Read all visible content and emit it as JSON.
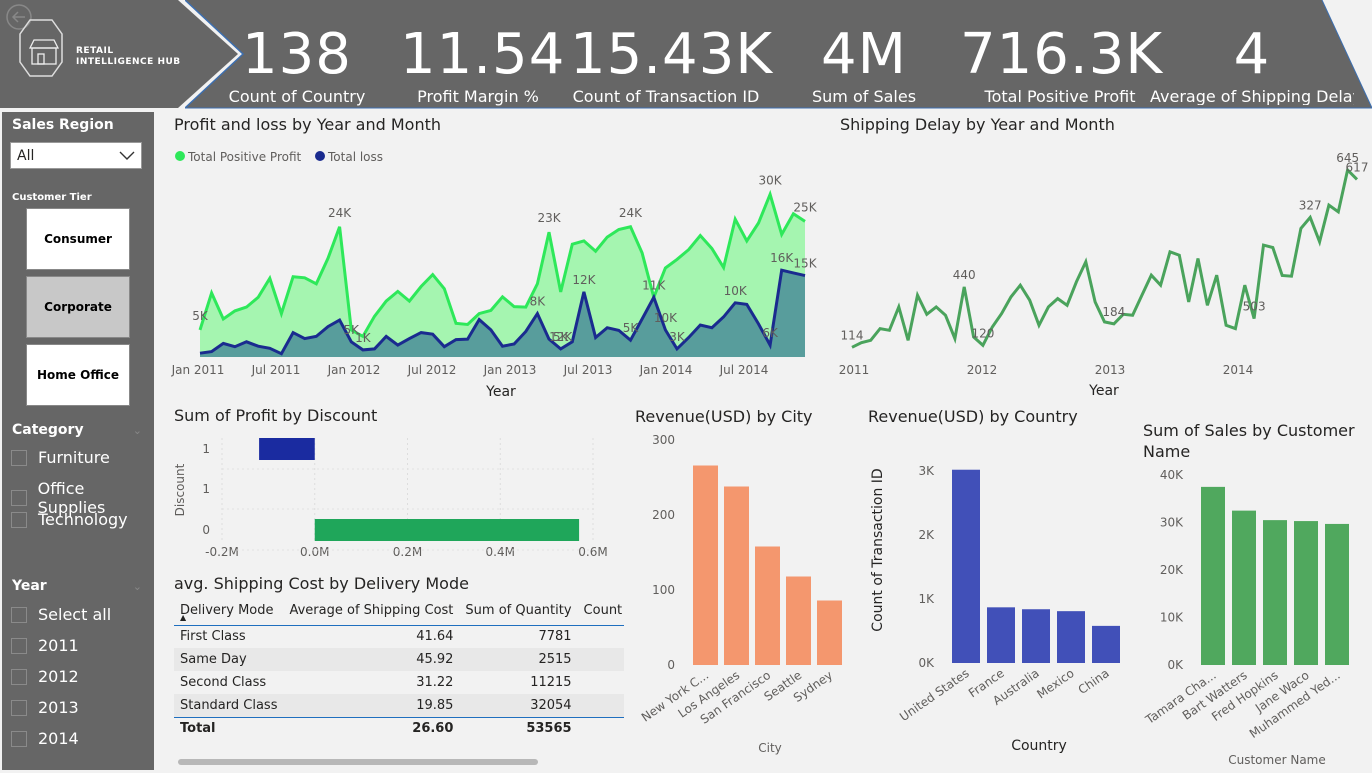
{
  "brand": {
    "line1": "RETAIL",
    "line2": "INTELLIGENCE HUB"
  },
  "kpis": [
    {
      "value": "138",
      "label": "Count of Country"
    },
    {
      "value": "11.54",
      "label": "Profit Margin %"
    },
    {
      "value": "15.43K",
      "label": "Count of Transaction ID"
    },
    {
      "value": "4M",
      "label": "Sum of Sales"
    },
    {
      "value": "716.3K",
      "label": "Total Positive Profit"
    },
    {
      "value": "4",
      "label": "Average of Shipping Delay"
    }
  ],
  "slicers": {
    "region": {
      "title": "Sales Region",
      "value": "All"
    },
    "tier": {
      "title": "Customer Tier",
      "options": [
        "Consumer",
        "Corporate",
        "Home Office"
      ],
      "selected": "Corporate"
    },
    "category": {
      "title": "Category",
      "options": [
        "Furniture",
        "Office Supplies",
        "Technology"
      ]
    },
    "year": {
      "title": "Year",
      "options": [
        "Select all",
        "2011",
        "2012",
        "2013",
        "2014"
      ]
    }
  },
  "colors": {
    "profit": "#2ee85a",
    "loss": "#1a2b8f",
    "delay": "#4aa35c",
    "discount_neg": "#1a2ba0",
    "discount_pos": "#1fa65a",
    "city": "#f4976e",
    "country": "#4150b8",
    "customer": "#50a85e",
    "panel": "#666666"
  },
  "table": {
    "title": "avg. Shipping Cost by Delivery Mode",
    "columns": [
      "Delivery Mode",
      "Average of Shipping Cost",
      "Sum of Quantity",
      "Count of"
    ],
    "rows": [
      [
        "First Class",
        "41.64",
        "7781"
      ],
      [
        "Same Day",
        "45.92",
        "2515"
      ],
      [
        "Second Class",
        "31.22",
        "11215"
      ],
      [
        "Standard Class",
        "19.85",
        "32054"
      ]
    ],
    "total": [
      "Total",
      "26.60",
      "53565"
    ]
  },
  "chart_data": [
    {
      "type": "area",
      "title": "Profit and loss by Year and Month",
      "xlabel": "Year",
      "ylabel": "",
      "x_ticks": [
        "Jan 2011",
        "Jul 2011",
        "Jan 2012",
        "Jul 2012",
        "Jan 2013",
        "Jul 2013",
        "Jan 2014",
        "Jul 2014"
      ],
      "ylim": [
        0,
        33000
      ],
      "legend_position": "top-left",
      "series": [
        {
          "name": "Total Positive Profit",
          "values": [
            5000,
            11800,
            7000,
            8500,
            9200,
            11000,
            14500,
            8000,
            14800,
            14600,
            13500,
            18200,
            24000,
            5000,
            3800,
            7500,
            10300,
            12100,
            10300,
            13000,
            15200,
            12600,
            6200,
            6000,
            8000,
            8600,
            11100,
            9300,
            9200,
            13500,
            23000,
            12000,
            20800,
            21400,
            19500,
            22100,
            23500,
            24000,
            19200,
            11000,
            16400,
            18000,
            19800,
            22400,
            20000,
            16500,
            25400,
            21400,
            24700,
            30000,
            22600,
            26400,
            25000
          ]
        },
        {
          "name": "Total loss",
          "values": [
            700,
            1000,
            2500,
            1900,
            2800,
            2000,
            1600,
            600,
            4500,
            3400,
            3800,
            5600,
            6800,
            2800,
            1300,
            1500,
            3800,
            2200,
            3400,
            4500,
            4200,
            1900,
            3200,
            3300,
            6900,
            5000,
            2000,
            2400,
            4700,
            8000,
            3300,
            1500,
            2800,
            12000,
            3600,
            5400,
            4900,
            3100,
            7000,
            11000,
            5000,
            1500,
            3600,
            5900,
            5400,
            7400,
            10000,
            9700,
            6100,
            2200,
            16000,
            15500,
            15000
          ]
        }
      ],
      "data_labels": [
        {
          "text": "5K",
          "series": 0,
          "index": 0
        },
        {
          "text": "24K",
          "series": 0,
          "index": 12
        },
        {
          "text": "5K",
          "series": 1,
          "index": 13
        },
        {
          "text": "1K",
          "series": 1,
          "index": 14
        },
        {
          "text": "8K",
          "series": 1,
          "index": 29
        },
        {
          "text": "23K",
          "series": 0,
          "index": 30
        },
        {
          "text": "12K",
          "series": 1,
          "index": 31
        },
        {
          "text": "5K",
          "series": 1,
          "index": 31
        },
        {
          "text": "12K",
          "series": 1,
          "index": 33
        },
        {
          "text": "24K",
          "series": 0,
          "index": 37
        },
        {
          "text": "5K",
          "series": 1,
          "index": 37
        },
        {
          "text": "11K",
          "series": 1,
          "index": 39
        },
        {
          "text": "10K",
          "series": 1,
          "index": 40
        },
        {
          "text": "3K",
          "series": 1,
          "index": 41
        },
        {
          "text": "10K",
          "series": 1,
          "index": 46
        },
        {
          "text": "30K",
          "series": 0,
          "index": 49
        },
        {
          "text": "6K",
          "series": 1,
          "index": 49
        },
        {
          "text": "16K",
          "series": 1,
          "index": 50
        },
        {
          "text": "25K",
          "series": 0,
          "index": 52
        },
        {
          "text": "15K",
          "series": 1,
          "index": 52
        }
      ]
    },
    {
      "type": "line",
      "title": "Shipping Delay by Year and Month",
      "xlabel": "Year",
      "x_ticks": [
        "2011",
        "2012",
        "2013",
        "2014"
      ],
      "ylim": [
        100,
        660
      ],
      "values": [
        114,
        128,
        135,
        170,
        165,
        235,
        135,
        270,
        213,
        235,
        210,
        140,
        295,
        145,
        120,
        175,
        215,
        265,
        300,
        255,
        180,
        235,
        260,
        240,
        310,
        370,
        250,
        190,
        184,
        213,
        210,
        270,
        330,
        300,
        400,
        390,
        250,
        380,
        240,
        330,
        180,
        170,
        300,
        200,
        420,
        413,
        329,
        327,
        470,
        503,
        430,
        540,
        520,
        645,
        617
      ],
      "data_labels": [
        {
          "text": "114",
          "index": 0
        },
        {
          "text": "440",
          "index": 12
        },
        {
          "text": "120",
          "index": 14
        },
        {
          "text": "184",
          "index": 28
        },
        {
          "text": "503",
          "index": 43
        },
        {
          "text": "327",
          "index": 49
        },
        {
          "text": "645",
          "index": 53
        },
        {
          "text": "617",
          "index": 54
        }
      ]
    },
    {
      "type": "bar",
      "orientation": "horizontal",
      "title": "Sum of Profit by Discount",
      "ylabel": "Discount",
      "categories": [
        "1",
        "1",
        "0"
      ],
      "values": [
        -0.12,
        0,
        0.57
      ],
      "xlim": [
        -0.2,
        0.6
      ],
      "x_ticks": [
        "-0.2M",
        "0.0M",
        "0.2M",
        "0.4M",
        "0.6M"
      ]
    },
    {
      "type": "bar",
      "title": "Revenue(USD) by City",
      "xlabel": "City",
      "categories": [
        "New York C...",
        "Los Angeles",
        "San Francisco",
        "Seattle",
        "Sydney"
      ],
      "values": [
        266,
        238,
        158,
        118,
        86
      ],
      "ylim": [
        0,
        300
      ],
      "y_ticks": [
        "0",
        "100",
        "200",
        "300"
      ]
    },
    {
      "type": "bar",
      "title": "Revenue(USD) by Country",
      "xlabel": "Country",
      "ylabel": "Count of Transaction ID",
      "categories": [
        "United States",
        "France",
        "Australia",
        "Mexico",
        "China"
      ],
      "values": [
        3020,
        870,
        840,
        810,
        580
      ],
      "ylim": [
        0,
        3000
      ],
      "y_ticks": [
        "0K",
        "1K",
        "2K",
        "3K"
      ]
    },
    {
      "type": "bar",
      "title": "Sum of Sales by Customer Name",
      "xlabel": "Customer Name",
      "categories": [
        "Tamara Cha...",
        "Bart Watters",
        "Fred Hopkins",
        "Jane Waco",
        "Muhammed Yed..."
      ],
      "values": [
        37500,
        32500,
        30500,
        30300,
        29700
      ],
      "ylim": [
        0,
        40000
      ],
      "y_ticks": [
        "0K",
        "10K",
        "20K",
        "30K",
        "40K"
      ]
    }
  ]
}
